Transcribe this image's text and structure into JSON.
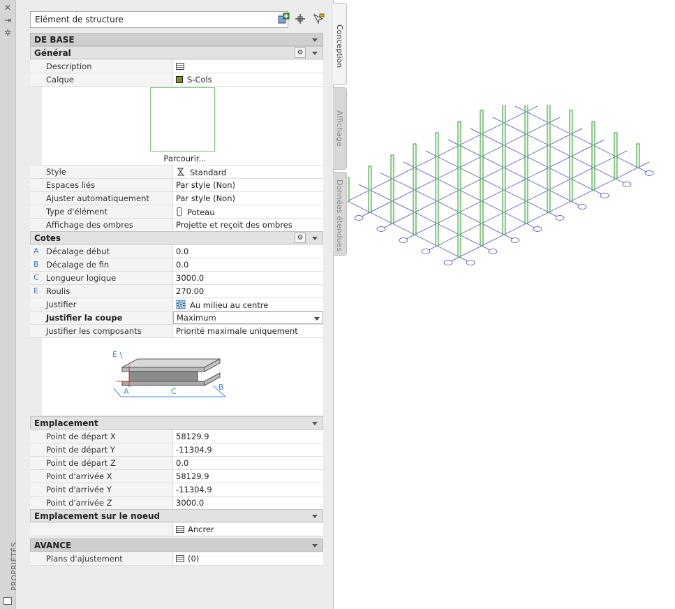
{
  "panel": {
    "side_label": "PROPRIÉTÉS",
    "object_type": "Elément de structure",
    "tabs": [
      "Conception",
      "Affichage",
      "Données étendues"
    ]
  },
  "sections": {
    "de_base": "DE BASE",
    "general": "Général",
    "cotes": "Cotes",
    "emplacement": "Emplacement",
    "emplacement_noeud": "Emplacement sur le noeud",
    "avance": "AVANCE"
  },
  "general": {
    "description_label": "Description",
    "calque_label": "Calque",
    "calque_value": "S-Cols",
    "browse_label": "Parcourir...",
    "style_label": "Style",
    "style_value": "Standard",
    "espaces_label": "Espaces liés",
    "espaces_value": "Par style (Non)",
    "ajuster_label": "Ajuster automatiquement",
    "ajuster_value": "Par style (Non)",
    "type_label": "Type d'élément",
    "type_value": "Poteau",
    "ombres_label": "Affichage des ombres",
    "ombres_value": "Projette et reçoit des ombres"
  },
  "cotes": {
    "decalage_debut_letter": "A",
    "decalage_debut_label": "Décalage début",
    "decalage_debut_value": "0.0",
    "decalage_fin_letter": "B",
    "decalage_fin_label": "Décalage de fin",
    "decalage_fin_value": "0.0",
    "longueur_letter": "C",
    "longueur_label": "Longueur logique",
    "longueur_value": "3000.0",
    "roulis_letter": "E",
    "roulis_label": "Roulis",
    "roulis_value": "270.00",
    "justifier_label": "Justifier",
    "justifier_value": "Au milieu au centre",
    "justifier_coupe_label": "Justifier la coupe",
    "justifier_coupe_value": "Maximum",
    "justifier_comp_label": "Justifier les composants",
    "justifier_comp_value": "Priorité maximale uniquement",
    "diagram_labels": [
      "E",
      "A",
      "C",
      "B"
    ]
  },
  "emplacement": {
    "rows": [
      {
        "label": "Point de départ X",
        "value": "58129.9"
      },
      {
        "label": "Point de départ Y",
        "value": "-11304.9"
      },
      {
        "label": "Point de départ Z",
        "value": "0.0"
      },
      {
        "label": "Point d'arrivée X",
        "value": "58129.9"
      },
      {
        "label": "Point d'arrivée Y",
        "value": "-11304.9"
      },
      {
        "label": "Point d'arrivée Z",
        "value": "3000.0"
      }
    ]
  },
  "noeud": {
    "ancrer_value": "Ancrer"
  },
  "avance": {
    "plans_label": "Plans d'ajustement",
    "plans_value": "(0)"
  },
  "colors": {
    "column_green": "#2e9e2e",
    "grid_blue": "#3a3ad0",
    "layer_swatch": "#8a8a1e"
  }
}
